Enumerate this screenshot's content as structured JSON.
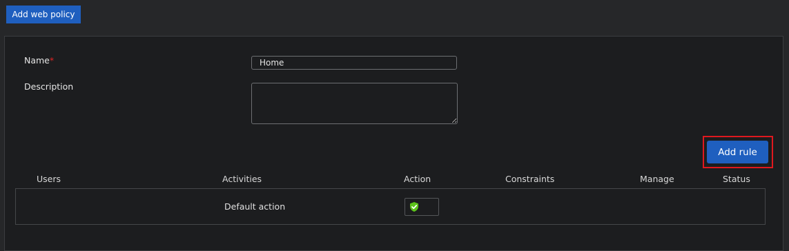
{
  "header": {
    "add_web_policy_label": "Add web policy"
  },
  "form": {
    "name_label": "Name",
    "name_required_mark": "*",
    "name_value": "Home",
    "description_label": "Description",
    "description_value": ""
  },
  "add_rule_label": "Add rule",
  "table": {
    "columns": [
      "Users",
      "Activities",
      "Action",
      "Constraints",
      "Manage",
      "Status"
    ],
    "rows": [
      {
        "users": "",
        "activities": "Default action",
        "action_icon": "shield-check-icon",
        "constraints": "",
        "manage": "",
        "status": ""
      }
    ]
  },
  "colors": {
    "accent": "#1f5fbf",
    "highlight": "#e0181e",
    "allow": "#5cc31b"
  }
}
